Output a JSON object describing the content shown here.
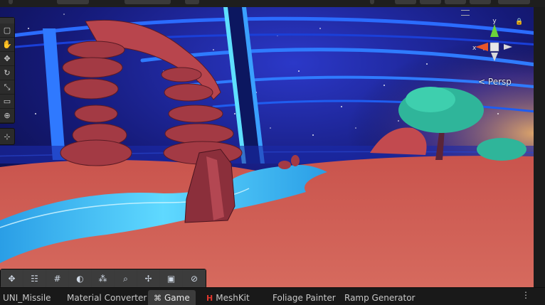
{
  "viewport": {
    "camera_mode": "Persp",
    "gizmo_axes": {
      "x": "x",
      "y": "y"
    }
  },
  "tool_palette": {
    "icons": [
      "cube-icon",
      "hand-icon",
      "move-icon",
      "rotate-icon",
      "scale-icon",
      "rect-icon",
      "transform-icon",
      "custom-tool-icon"
    ]
  },
  "bottom_toolbar": {
    "icons": [
      "move-gizmo-icon",
      "layers-icon",
      "grid-icon",
      "shading-icon",
      "nodes-icon",
      "search-icon",
      "navigate-icon",
      "camera-icon",
      "compass-icon"
    ]
  },
  "tabs": [
    {
      "label": "UNI_Missile",
      "icon": ""
    },
    {
      "label": "Material Converter",
      "icon": ""
    },
    {
      "label": "Game",
      "icon": "gamepad-icon",
      "active": true
    },
    {
      "label": "MeshKit",
      "icon": "meshkit-icon"
    },
    {
      "label": "Foliage Painter",
      "icon": ""
    },
    {
      "label": "Ramp Generator",
      "icon": ""
    }
  ],
  "colors": {
    "sky_top": "#0b0f4a",
    "sky_glow": "#2a2fb0",
    "ground": "#c9584f",
    "water": "#3cc8f5",
    "rock": "#8a2f3b",
    "tree": "#2fb59a",
    "gizmo_x": "#e8552a",
    "gizmo_y": "#6cd13a"
  }
}
